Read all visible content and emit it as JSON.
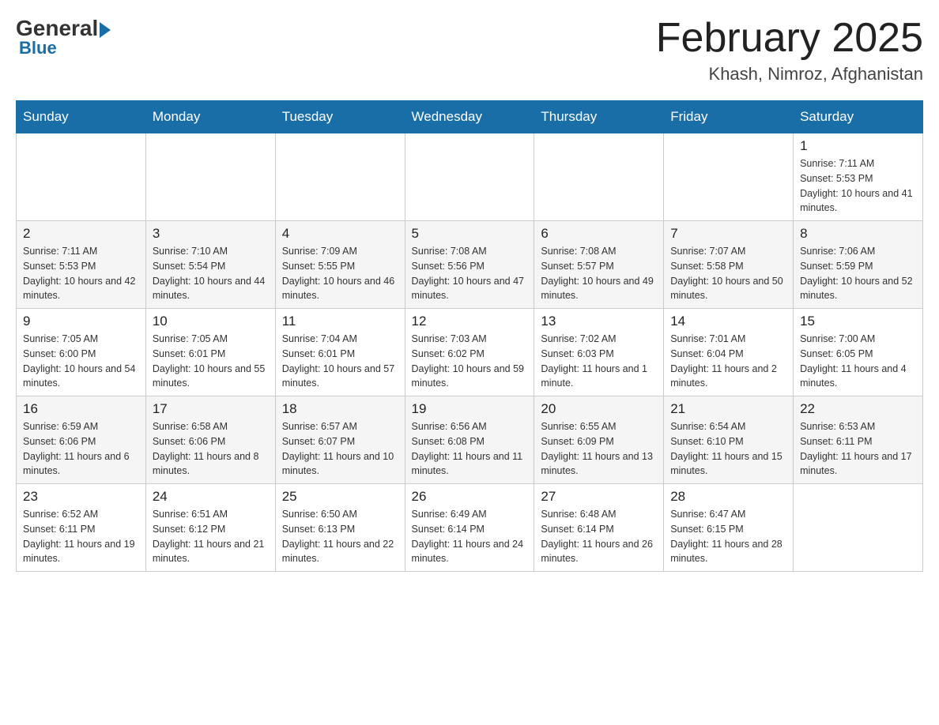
{
  "logo": {
    "general": "General",
    "blue": "Blue"
  },
  "title": {
    "month_year": "February 2025",
    "location": "Khash, Nimroz, Afghanistan"
  },
  "days_of_week": [
    "Sunday",
    "Monday",
    "Tuesday",
    "Wednesday",
    "Thursday",
    "Friday",
    "Saturday"
  ],
  "weeks": [
    [
      {
        "day": "",
        "sunrise": "",
        "sunset": "",
        "daylight": ""
      },
      {
        "day": "",
        "sunrise": "",
        "sunset": "",
        "daylight": ""
      },
      {
        "day": "",
        "sunrise": "",
        "sunset": "",
        "daylight": ""
      },
      {
        "day": "",
        "sunrise": "",
        "sunset": "",
        "daylight": ""
      },
      {
        "day": "",
        "sunrise": "",
        "sunset": "",
        "daylight": ""
      },
      {
        "day": "",
        "sunrise": "",
        "sunset": "",
        "daylight": ""
      },
      {
        "day": "1",
        "sunrise": "Sunrise: 7:11 AM",
        "sunset": "Sunset: 5:53 PM",
        "daylight": "Daylight: 10 hours and 41 minutes."
      }
    ],
    [
      {
        "day": "2",
        "sunrise": "Sunrise: 7:11 AM",
        "sunset": "Sunset: 5:53 PM",
        "daylight": "Daylight: 10 hours and 42 minutes."
      },
      {
        "day": "3",
        "sunrise": "Sunrise: 7:10 AM",
        "sunset": "Sunset: 5:54 PM",
        "daylight": "Daylight: 10 hours and 44 minutes."
      },
      {
        "day": "4",
        "sunrise": "Sunrise: 7:09 AM",
        "sunset": "Sunset: 5:55 PM",
        "daylight": "Daylight: 10 hours and 46 minutes."
      },
      {
        "day": "5",
        "sunrise": "Sunrise: 7:08 AM",
        "sunset": "Sunset: 5:56 PM",
        "daylight": "Daylight: 10 hours and 47 minutes."
      },
      {
        "day": "6",
        "sunrise": "Sunrise: 7:08 AM",
        "sunset": "Sunset: 5:57 PM",
        "daylight": "Daylight: 10 hours and 49 minutes."
      },
      {
        "day": "7",
        "sunrise": "Sunrise: 7:07 AM",
        "sunset": "Sunset: 5:58 PM",
        "daylight": "Daylight: 10 hours and 50 minutes."
      },
      {
        "day": "8",
        "sunrise": "Sunrise: 7:06 AM",
        "sunset": "Sunset: 5:59 PM",
        "daylight": "Daylight: 10 hours and 52 minutes."
      }
    ],
    [
      {
        "day": "9",
        "sunrise": "Sunrise: 7:05 AM",
        "sunset": "Sunset: 6:00 PM",
        "daylight": "Daylight: 10 hours and 54 minutes."
      },
      {
        "day": "10",
        "sunrise": "Sunrise: 7:05 AM",
        "sunset": "Sunset: 6:01 PM",
        "daylight": "Daylight: 10 hours and 55 minutes."
      },
      {
        "day": "11",
        "sunrise": "Sunrise: 7:04 AM",
        "sunset": "Sunset: 6:01 PM",
        "daylight": "Daylight: 10 hours and 57 minutes."
      },
      {
        "day": "12",
        "sunrise": "Sunrise: 7:03 AM",
        "sunset": "Sunset: 6:02 PM",
        "daylight": "Daylight: 10 hours and 59 minutes."
      },
      {
        "day": "13",
        "sunrise": "Sunrise: 7:02 AM",
        "sunset": "Sunset: 6:03 PM",
        "daylight": "Daylight: 11 hours and 1 minute."
      },
      {
        "day": "14",
        "sunrise": "Sunrise: 7:01 AM",
        "sunset": "Sunset: 6:04 PM",
        "daylight": "Daylight: 11 hours and 2 minutes."
      },
      {
        "day": "15",
        "sunrise": "Sunrise: 7:00 AM",
        "sunset": "Sunset: 6:05 PM",
        "daylight": "Daylight: 11 hours and 4 minutes."
      }
    ],
    [
      {
        "day": "16",
        "sunrise": "Sunrise: 6:59 AM",
        "sunset": "Sunset: 6:06 PM",
        "daylight": "Daylight: 11 hours and 6 minutes."
      },
      {
        "day": "17",
        "sunrise": "Sunrise: 6:58 AM",
        "sunset": "Sunset: 6:06 PM",
        "daylight": "Daylight: 11 hours and 8 minutes."
      },
      {
        "day": "18",
        "sunrise": "Sunrise: 6:57 AM",
        "sunset": "Sunset: 6:07 PM",
        "daylight": "Daylight: 11 hours and 10 minutes."
      },
      {
        "day": "19",
        "sunrise": "Sunrise: 6:56 AM",
        "sunset": "Sunset: 6:08 PM",
        "daylight": "Daylight: 11 hours and 11 minutes."
      },
      {
        "day": "20",
        "sunrise": "Sunrise: 6:55 AM",
        "sunset": "Sunset: 6:09 PM",
        "daylight": "Daylight: 11 hours and 13 minutes."
      },
      {
        "day": "21",
        "sunrise": "Sunrise: 6:54 AM",
        "sunset": "Sunset: 6:10 PM",
        "daylight": "Daylight: 11 hours and 15 minutes."
      },
      {
        "day": "22",
        "sunrise": "Sunrise: 6:53 AM",
        "sunset": "Sunset: 6:11 PM",
        "daylight": "Daylight: 11 hours and 17 minutes."
      }
    ],
    [
      {
        "day": "23",
        "sunrise": "Sunrise: 6:52 AM",
        "sunset": "Sunset: 6:11 PM",
        "daylight": "Daylight: 11 hours and 19 minutes."
      },
      {
        "day": "24",
        "sunrise": "Sunrise: 6:51 AM",
        "sunset": "Sunset: 6:12 PM",
        "daylight": "Daylight: 11 hours and 21 minutes."
      },
      {
        "day": "25",
        "sunrise": "Sunrise: 6:50 AM",
        "sunset": "Sunset: 6:13 PM",
        "daylight": "Daylight: 11 hours and 22 minutes."
      },
      {
        "day": "26",
        "sunrise": "Sunrise: 6:49 AM",
        "sunset": "Sunset: 6:14 PM",
        "daylight": "Daylight: 11 hours and 24 minutes."
      },
      {
        "day": "27",
        "sunrise": "Sunrise: 6:48 AM",
        "sunset": "Sunset: 6:14 PM",
        "daylight": "Daylight: 11 hours and 26 minutes."
      },
      {
        "day": "28",
        "sunrise": "Sunrise: 6:47 AM",
        "sunset": "Sunset: 6:15 PM",
        "daylight": "Daylight: 11 hours and 28 minutes."
      },
      {
        "day": "",
        "sunrise": "",
        "sunset": "",
        "daylight": ""
      }
    ]
  ]
}
